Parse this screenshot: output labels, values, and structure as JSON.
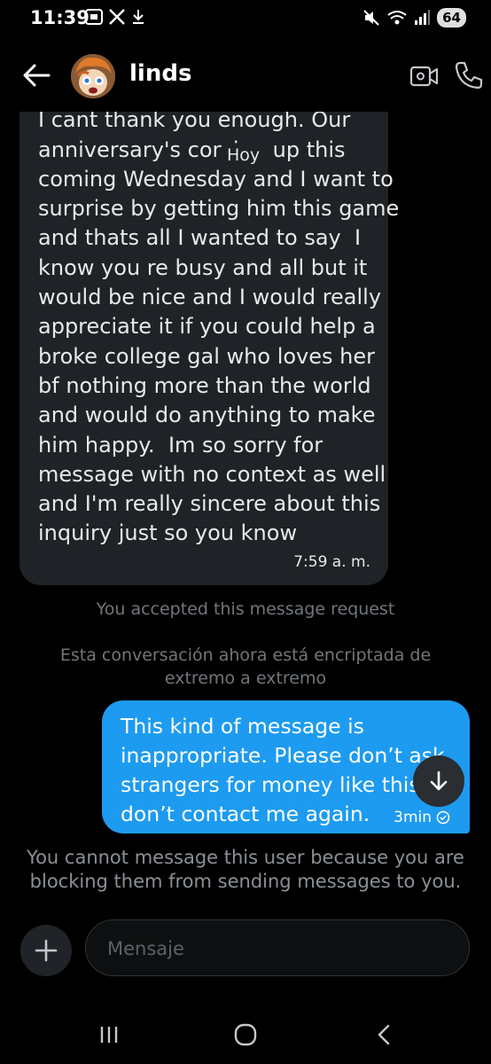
{
  "status_bar": {
    "time": "11:39",
    "battery": "64",
    "icons": [
      "screenshot-icon",
      "x-logo-icon",
      "download-icon",
      "mute-icon",
      "wifi-icon",
      "signal-icon"
    ]
  },
  "header": {
    "contact_name": "linds",
    "icons": [
      "back-arrow-icon",
      "avatar",
      "video-call-icon",
      "phone-icon"
    ]
  },
  "messages": {
    "incoming": {
      "text": "this for me but if you ever do this\nI cant thank you enough. Our\nanniversary's coming up this\ncoming Wednesday and I want to\nsurprise by getting him this game\nand thats all I wanted to say  I\nknow you re busy and all but it\nwould be nice and I would really\nappreciate it if you could help a\nbroke college gal who loves her\nbf nothing more than the world\nand would do anything to make\nhim happy.  Im so sorry for\nmessage with no context as well\nand I'm really sincere about this\ninquiry just so you know",
      "time": "7:59 a. m."
    },
    "date_chip": "Hoy",
    "request_note": "You accepted this message request",
    "encryption_note": "Esta conversación ahora está encriptada de\nextremo a extremo",
    "outgoing": {
      "text": "This kind of message is\ninappropriate. Please don’t ask\nstrangers for money like this,\ndon’t contact me again.",
      "time": "3min"
    },
    "blocked_note": "You cannot message this user because you are\nblocking them from sending messages to you."
  },
  "composer": {
    "placeholder": "Mensaje"
  },
  "colors": {
    "background": "#000000",
    "incoming_bubble": "#1f2226",
    "outgoing_bubble": "#1d9bf0",
    "muted_text": "#71767b"
  }
}
